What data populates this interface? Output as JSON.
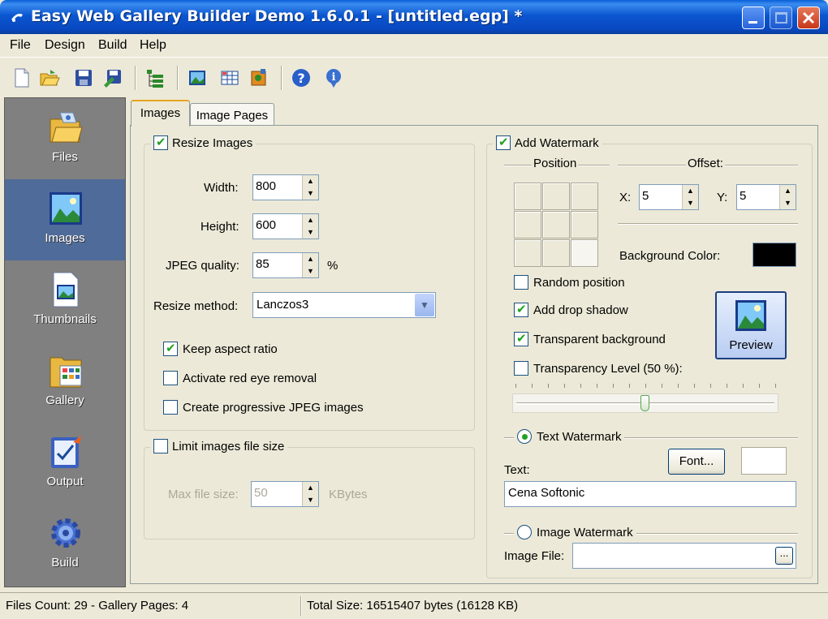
{
  "window": {
    "title": "Easy Web Gallery Builder Demo 1.6.0.1 - [untitled.egp] *"
  },
  "menu": [
    "File",
    "Design",
    "Build",
    "Help"
  ],
  "toolbar_icons": [
    "new-icon",
    "open-icon",
    "save-icon",
    "save-as-icon",
    "tree-icon",
    "image-icon",
    "table-icon",
    "plugin-icon",
    "help-icon",
    "info-icon"
  ],
  "sidebar": {
    "items": [
      {
        "label": "Files",
        "icon": "folder-icon"
      },
      {
        "label": "Images",
        "icon": "image-icon",
        "active": true
      },
      {
        "label": "Thumbnails",
        "icon": "thumbnail-icon"
      },
      {
        "label": "Gallery",
        "icon": "gallery-icon"
      },
      {
        "label": "Output",
        "icon": "output-icon"
      },
      {
        "label": "Build",
        "icon": "gear-icon"
      }
    ]
  },
  "tabs": [
    "Images",
    "Image Pages"
  ],
  "resize": {
    "legend": "Resize Images",
    "checked": true,
    "width_label": "Width:",
    "width": "800",
    "height_label": "Height:",
    "height": "600",
    "jpeg_label": "JPEG quality:",
    "jpeg": "85",
    "jpeg_unit": "%",
    "method_label": "Resize method:",
    "method": "Lanczos3",
    "keep_aspect": "Keep aspect ratio",
    "red_eye": "Activate red eye removal",
    "progressive": "Create progressive JPEG images"
  },
  "limit": {
    "legend": "Limit images file size",
    "max_label": "Max file size:",
    "max_value": "50",
    "unit": "KBytes"
  },
  "watermark": {
    "legend": "Add Watermark",
    "checked": true,
    "position_label": "Position",
    "offset_label": "Offset:",
    "x_label": "X:",
    "x_value": "5",
    "y_label": "Y:",
    "y_value": "5",
    "bg_color_label": "Background Color:",
    "bg_color": "#000000",
    "random_position": "Random position",
    "drop_shadow": "Add drop shadow",
    "transparent_bg": "Transparent background",
    "transparency_level": "Transparency Level (50 %):",
    "transparency_value": 0.5,
    "preview_label": "Preview",
    "text_watermark": "Text Watermark",
    "font_button": "Font...",
    "text_label": "Text:",
    "text_value": "Cena Softonic",
    "image_watermark": "Image Watermark",
    "image_file_label": "Image File:",
    "image_file_value": "",
    "browse_button": "..."
  },
  "status": {
    "left": "Files Count: 29 - Gallery Pages: 4",
    "right": "Total Size: 16515407 bytes (16128 KB)"
  }
}
